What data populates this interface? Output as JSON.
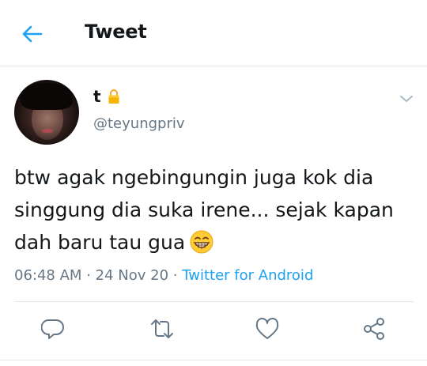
{
  "header": {
    "title": "Tweet",
    "back_icon": "arrow-left-icon",
    "accent": "#1da1f2"
  },
  "tweet": {
    "display_name": "t",
    "protected_icon": "lock-icon",
    "handle": "@teyungpriv",
    "text": "btw agak ngebingungin juga kok dia\nsinggung dia suka irene... sejak kapan\ndah baru tau gua",
    "emoji": "grinning-face-emoji",
    "time": "06:48 AM",
    "separator": "·",
    "date": "24 Nov 20",
    "source": "Twitter for Android",
    "menu_icon": "chevron-down-icon"
  },
  "actions": [
    {
      "name": "reply",
      "icon": "reply-icon"
    },
    {
      "name": "retweet",
      "icon": "retweet-icon"
    },
    {
      "name": "like",
      "icon": "heart-icon"
    },
    {
      "name": "share",
      "icon": "share-icon"
    }
  ],
  "colors": {
    "text": "#14171a",
    "secondary": "#657786",
    "link": "#1da1f2",
    "divider": "#e1e8ed"
  }
}
